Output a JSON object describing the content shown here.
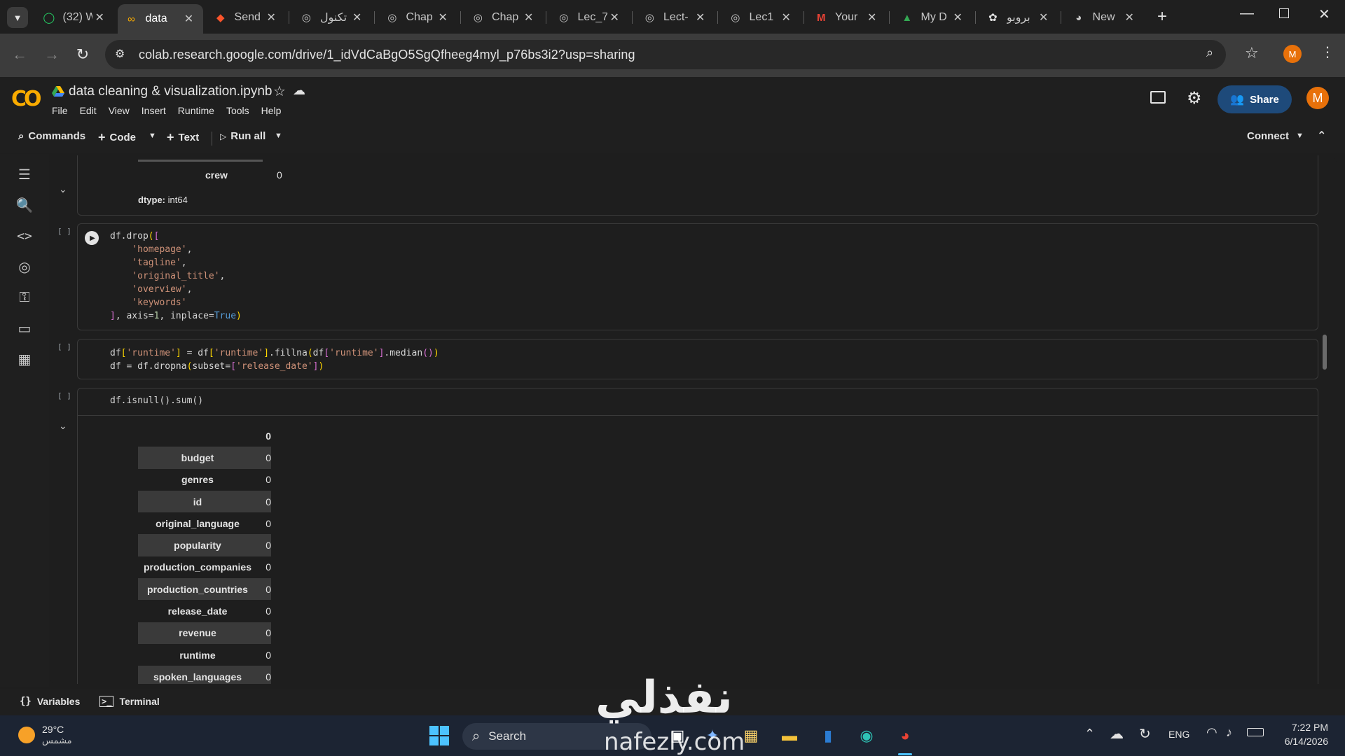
{
  "browser": {
    "tabs": [
      {
        "title": "(32) W",
        "icon": "whatsapp-icon",
        "active": false
      },
      {
        "title": "data",
        "icon": "colab-icon",
        "active": true
      },
      {
        "title": "Send",
        "icon": "brave-icon",
        "active": false
      },
      {
        "title": "تكنول",
        "icon": "globe-icon",
        "active": false
      },
      {
        "title": "Chap",
        "icon": "globe-icon",
        "active": false
      },
      {
        "title": "Chap",
        "icon": "globe-icon",
        "active": false
      },
      {
        "title": "Lec_7",
        "icon": "globe-icon",
        "active": false
      },
      {
        "title": "Lect-",
        "icon": "globe-icon",
        "active": false
      },
      {
        "title": "Lec1",
        "icon": "globe-icon",
        "active": false
      },
      {
        "title": "Your",
        "icon": "gmail-icon",
        "active": false
      },
      {
        "title": "My D",
        "icon": "drive-icon",
        "active": false
      },
      {
        "title": "بروبو",
        "icon": "chatgpt-icon",
        "active": false
      },
      {
        "title": "New",
        "icon": "chrome-icon",
        "active": false
      }
    ],
    "url": "colab.research.google.com/drive/1_idVdCaBgO5SgQfheeg4myl_p76bs3i2?usp=sharing",
    "profile_initial": "M"
  },
  "colab": {
    "notebook_title": "data cleaning & visualization.ipynb",
    "menu": [
      "File",
      "Edit",
      "View",
      "Insert",
      "Runtime",
      "Tools",
      "Help"
    ],
    "share_label": "Share",
    "avatar_initial": "M",
    "toolbar": {
      "commands": "Commands",
      "code": "Code",
      "text": "Text",
      "run_all": "Run all",
      "connect": "Connect"
    }
  },
  "cells": {
    "prev_output": {
      "crew_label": "crew",
      "crew_value": "0",
      "dtype_label": "dtype:",
      "dtype_value": "int64"
    },
    "cell1_marker": "[ ]",
    "cell2_marker": "[ ]",
    "cell3_marker": "[ ]",
    "cell3_code": "df.isnull().sum()",
    "output_header": "0",
    "output_rows": [
      {
        "name": "budget",
        "value": "0"
      },
      {
        "name": "genres",
        "value": "0"
      },
      {
        "name": "id",
        "value": "0"
      },
      {
        "name": "original_language",
        "value": "0"
      },
      {
        "name": "popularity",
        "value": "0"
      },
      {
        "name": "production_companies",
        "value": "0"
      },
      {
        "name": "production_countries",
        "value": "0"
      },
      {
        "name": "release_date",
        "value": "0"
      },
      {
        "name": "revenue",
        "value": "0"
      },
      {
        "name": "runtime",
        "value": "0"
      },
      {
        "name": "spoken_languages",
        "value": "0"
      }
    ]
  },
  "footer": {
    "variables": "Variables",
    "terminal": "Terminal"
  },
  "taskbar": {
    "weather_temp": "29°C",
    "weather_desc": "مشمس",
    "search": "Search",
    "lang": "ENG",
    "time": "7:22 PM",
    "date": "6/14/2026"
  },
  "watermark": {
    "arabic": "نفذلي",
    "latin": "nafezly.com"
  }
}
